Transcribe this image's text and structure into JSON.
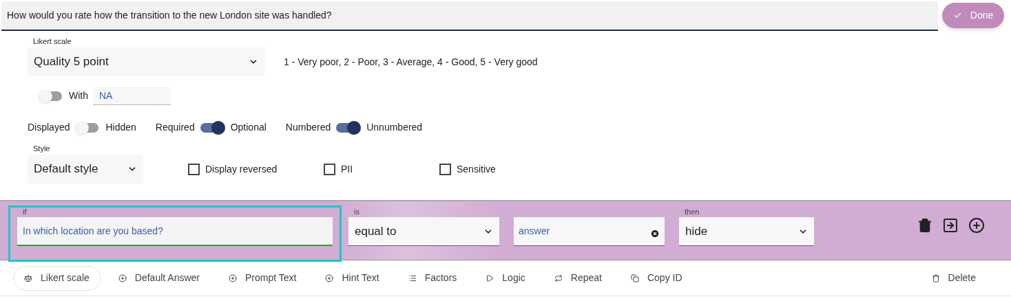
{
  "question": {
    "value": "How would you rate how the transition to the new London site was handled?"
  },
  "done_button": {
    "label": "Done"
  },
  "likert": {
    "label": "Likert scale",
    "value": "Quality 5 point",
    "description": "1 - Very poor, 2 - Poor, 3 - Average, 4 - Good, 5 - Very good"
  },
  "na_option": {
    "on": false,
    "label": "With",
    "value": "NA"
  },
  "toggles": [
    {
      "left": "Displayed",
      "right": "Hidden",
      "on": false
    },
    {
      "left": "Required",
      "right": "Optional",
      "on": true
    },
    {
      "left": "Numbered",
      "right": "Unnumbered",
      "on": true
    }
  ],
  "style": {
    "label": "Style",
    "value": "Default style"
  },
  "checkboxes": [
    {
      "label": "Display reversed",
      "checked": false
    },
    {
      "label": "PII",
      "checked": false
    },
    {
      "label": "Sensitive",
      "checked": false
    }
  ],
  "logic": {
    "if_label": "if",
    "if_value": "In which location are you based?",
    "if_focused": true,
    "is_label": "is",
    "is_value": "equal to",
    "answer_value": "answer",
    "then_label": "then",
    "then_value": "hide"
  },
  "toolbar": [
    {
      "label": "Likert scale",
      "selected": true
    },
    {
      "label": "Default Answer",
      "selected": false
    },
    {
      "label": "Prompt Text",
      "selected": false
    },
    {
      "label": "Hint Text",
      "selected": false
    },
    {
      "label": "Factors",
      "selected": false
    },
    {
      "label": "Logic",
      "selected": false
    },
    {
      "label": "Repeat",
      "selected": false
    },
    {
      "label": "Copy ID",
      "selected": false
    },
    {
      "label": "Delete",
      "selected": false
    }
  ]
}
